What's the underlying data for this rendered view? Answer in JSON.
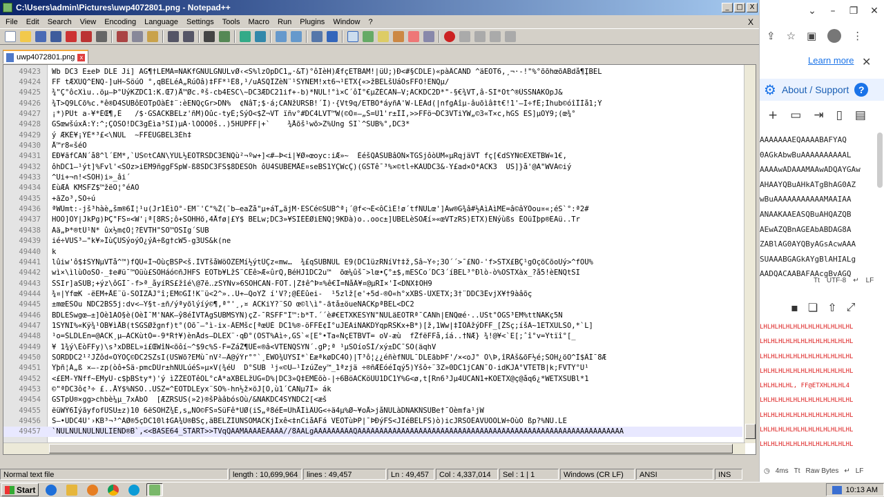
{
  "window": {
    "title": "C:\\Users\\admin\\Pictures\\uwp4072801.png - Notepad++",
    "controls": [
      "_",
      "□",
      "X"
    ]
  },
  "menu": [
    "File",
    "Edit",
    "Search",
    "View",
    "Encoding",
    "Language",
    "Settings",
    "Tools",
    "Macro",
    "Run",
    "Plugins",
    "Window",
    "?"
  ],
  "menu_close": "X",
  "tab": {
    "label": "uwp4072801.png",
    "close": "x"
  },
  "editor": {
    "lines": [
      {
        "n": "49423",
        "t": "Wb DC3 E±eÞ DLE Ji] ÃG¶†LEMÀ=NAKfGNULGNULvØ‹<S%lzOpDC1„·&T)°ôIèH)ÆfçETBAM!|üÛ;)Ð<#§CDLE)«pàÂCAND ^äEOT6‚¸¬·-!\"%°õõhœõÃBdå¶ĮBEL"
      },
      {
        "n": "49424",
        "t": "FF tÆXUQ^ENQ-]uH~ŠöúO °‚qBELéÀ„RúÖâ)‡FF*¹Ê8‚¹/uÁSQÎZèN¨¹SYNEM!xt6¬¹ETX{«>žBELšÜáÓsFFO!ENQµ/"
      },
      {
        "n": "49425",
        "t": "¾\"Ç°ôcXìu..öµ–Þ°ÜýKZDC1:K.Œ7)Å™Øc.ªš-cb4ESC\\~DC3ÆDC21if+-b)*NUL!°ì×C´ôÎ°€µŽÈCAN—V;ACKDC2D*\"-§€¾VT,â-SI*Õt^®ÛSSNAKÕpJ&"
      },
      {
        "n": "49426",
        "t": "¾T>Q9LCõ%c.*ê®D4SUBôEOTpÒàÈ‡¨:èENQçGr>DÑ%  ¢NâT;$·á;CANžURSB!´Î)·{Vt9q/ETBÒ*áyñÃ'W-LÈÁd(|nfgÁîµ-âuõìâ‡t€!1'—Ì÷fÊ;Íhub©óîÎÌå1;Ÿ"
      },
      {
        "n": "49427",
        "t": "¡*)PÛt a-¥*ÉŒ¶,È   /$·GSACKBELz'ñM)Ôûc-tyÈ;SýÔ<$Ž¬VT ïñv°#DC4LVT™W(©O¤–„Š=Ù1'r±ÎÌ,>>FFö¬DC3VTiYW„©3«T×c,hGS ËŠ]µÖY9;(œ¾°"
      },
      {
        "n": "49428",
        "t": "GSœwšúxÂ:Ý:^;ÇÕSO!DC3gÈìa³SI)µÃ·lÒÒÒ0š..)5HÛPFF|+`    ¾Åõš¹wõ>Z%Üng SI`^SUB%°,DC3*"
      },
      {
        "n": "49429",
        "t": "ý ÆKÈ¥¡ÝÈ*³£<\\NUL  ~FFÈÜGBEL3Èh‡"
      },
      {
        "n": "49430",
        "t": "Å™r8«šéÕ"
      },
      {
        "n": "49431",
        "t": "ÉÐ¥ãfCAN´å8^l´EM*,`US©tCÃÑ\\ŸUL½EOTRSDC3ENQù²¬ºw+]<#—Þ<i|¥Ø»œoyc:iÆ»~  ÉéšQÁSUBâÖÑ×TGSjôòÛM«µRqjäVT fç[€dSYN©EXETBW«1€,"
      },
      {
        "n": "49432",
        "t": "ôhDC1–¹ýt]%Fvl'<SOz>iEM9ñggFSpW-ß8SDC3FS$8DESOh ôÜ4SUBEMÅÉ¤seBS1YÇWcÇ)(GSTê¯³%×©tl÷KÄÛDC3&-Y£ad×Ó*ACK3  ÚS]}å'@Ã\"WVÁ©iý"
      },
      {
        "n": "49433",
        "t": "^Ui+¬n!<SOH)i»_âi´"
      },
      {
        "n": "49434",
        "t": "ÈùÆÂ KMSFZ$™žëÕ¦°éÃÔ"
      },
      {
        "n": "49435",
        "t": "+ãZo³,SÒ÷ú"
      },
      {
        "n": "49436",
        "t": "ªWÜmt:-jš³hàè„šm®6Î¦¹u(Jr1ÉìO°-EM¨'C\"%Ž(¯b—eaŽå\"µ+áT„ãjM·ESCé©SUB^ª¡´@f<¬É<ôCìÉ!ø´tfNULœ']Âw®G¾â#½ÄìÁìME=â©âÝÔou¤«;éS`°:ª2#"
      },
      {
        "n": "49437",
        "t": "HOÕ]ÒY|JkPg)ÞÇ\"FS¤<W'¡ª[8RS;ô+SOHHõ,4Åfø|£Y$ BELw;DC3»¥SIÈÊØiENQ¦9KÐà)o..ooc±]UBELèSOÆí»«œVTzRS)ETX)ENýùßs ÊOüÎþp®EAü..Tr"
      },
      {
        "n": "49438",
        "t": "Ãä„Þ*®tÜ¹N* ûx½m¢Ô¦?ÉVTH\"SO™ÓSIg´SUB"
      },
      {
        "n": "49439",
        "t": "ié÷VUS³–\"k¥»ÎùÇUSýoýÔ¿ýÂ÷ßg†cW5-g3US&k(ne"
      },
      {
        "n": "49440",
        "t": "k"
      },
      {
        "n": "49441",
        "t": "lûiw'ô$‡SYNµVTå^™)fQÜ«Í¬ÒùçBSP<š.ÌVTšåWöÓZEMí½ýtÛÇz«mw…  ¾£qSUBNUL E9(DC1üzRNíV†‡ž,Šâ~Ÿ÷;3Ò´´>¯£ÑÕ-'f>STX£BÇ¹gOçöCõoUý>^fOÜ%"
      },
      {
        "n": "49442",
        "t": "wì×\\ìlùÒoSO-_‡e#ü¯™Oüù£SOHáó©ñJHFS EOTb¥LžŠ¨CÊê>Æ«ûrQ,BéHJ1DC2u™  õœ¼ûš¯>lœ•Ç°±$,mESCo´DC3´íBEL³°Ðlò-ò%OSTXàx_?å5!èENQtSI"
      },
      {
        "n": "49443",
        "t": "ŠSIr]aSUB;+ýz\\ôGÎ¯-f>ª_åyíRS£žîé\\@7ë‥zSYNv»6SOHCAN-FÖT.|Z‡ê^Þ¤%ê€Î=NåÂ¥¤@µRÎ×'Í<DNX‡ÔH9"
      },
      {
        "n": "49444",
        "t": "¾¤|YfœK -ëEM+ÅE¨ü-SOÌZÂJ°î;EM©GÌ!K¨ü<2^»..Ù+–QoYŽ í'V?;@ÉÉûei-  ¹5zlž[e'+5d-®O«h°xXBS-ÛXETX;3†¨DDC3ÊvjX¥†9àâõç"
      },
      {
        "n": "49445",
        "t": "±mœESOu NDC2BS5j:dv<–Ÿ§t-±ñ/ýªyõlýíý©¶,ª°'¸,¤ ACKiY?¨SO œ©l\\ì°-ãtå±öueNACKpªBEL<DC2"
      },
      {
        "n": "49446",
        "t": "BDLEŠwgœ—±]Òè1ÃÕ§è(ÕèÍ¯M'NAK—ŷ8éÌVTÄgSUBMSYN)çZ-¯RSFF\"Ï™:b*T.´´è#€ETXKESYN\"NULäEOTRª¯CANh|ENQœé·..USt°ÓGS³EM%ttNAKç5N"
      },
      {
        "n": "49447",
        "t": "1SYNI%«Kÿ¾¹ÕB¥ìÅB(tSGSØžgnf)t°(Õõ¯—°ì-ix-ÂEMšc[ªœÙÈ DC1%®-öFFÈ¢Ì°uJEAiNAKDÝqpRSKx+B*)[ž,1Ww|‡ÎÒÂžýDFF_[ŽŠç;íšÀ~1ETXULSO,*`L]"
      },
      {
        "n": "49448",
        "t": "¹o=ŠLDLEn=@ACK¸µ–ACKùtÒ=-9*R†¥)ènÅds—DLEX¨·qÐ°(ÕST%Ãì÷,GS`«[E°•Ta«ÑçETBVT= oV-æù  fŽfëFFå,íá..†NÆ} ¾!@¥<`E[;ˆî°v=Ÿtïî°[_"
      },
      {
        "n": "49449",
        "t": "¥ 1¾ý\\ÈòFFy)\\s³xDBEL»i£ŒWîÑ<õôí~^$9c%S-F=ZáŽ¶ÛÊ«®â<VTENQSYN´.gP;ª ¹µSOíoŠÍ/xý±DC¯SO(äqhV"
      },
      {
        "n": "49450",
        "t": "SORDDC2¹²JŽôd«ÓÝÕÇ©DC2SZsI(USWõ?EMù¯nV²—Â@ýÝr°°`¸ÈWÕ¾ÚŸSI*`ÈæªkøDC4Ò)|T³ô¦¿¿éñèfNUL¯DLEãbÞF'/×<oJ° Õ\\Þ,îRÁš&õF½é;SOH¿öO^Ì$ÂÍ¯8Æ"
      },
      {
        "n": "49451",
        "t": "Ÿþñ¦Á„ß ×—-zp(òô+Šä-pmcDÜr±hNULúéŠ»µ×V(¾éU  D°SUB ¹j«©U—¹ÍzúZey™_1ªzjä ÷®ñÆÉóéÍqý5)Ÿšô÷¨3Z»0DC1jCAN¯Ö-idKJÃ°VTETB|k;FVTŸ°Ù¹"
      },
      {
        "n": "49452",
        "t": "<£EM-ŸÑff~EMyÜ-c$þBSty*)'ý ìŽŽEOTêÕL°cÂ*aXBELžÜG«D%|DC3»Q‡EMÉõò-|÷6BöACKöÜÜ1DC1Ÿ%G<ø,t[Rn6³Jµ4ÛCAN1+KÓETX@ç@åq6¿*WETXSUBl*1"
      },
      {
        "n": "49453",
        "t": "©\"ªDC3ô¢³÷ £..ÅŸ$%NSO..USZ=^EOTDLEyx¨SO%-hn½ž×öJ[Õ,ù1´CANµ7Î» ák"
      },
      {
        "n": "49454",
        "t": "GSTpÜ®×gg>chbè¼µ_7xÂbÓ  [ÆZRSUS(»2)®šPàâbósOù/&NAKDC4SYNDC2[<æš"
      },
      {
        "n": "49455",
        "t": "ëüWÝ6ÍýãyfofÜSU±z)10 6ëSOHŽ¾È,s„ÑO©FS¤SüFê*UØ(iS„ª8éÊ=ÜhÅÍìÂÜG<÷ä4µ%Ø~¥oÅ>jåNULàDNAKÑSUBe†¯Ôèmfa¹jW"
      },
      {
        "n": "49456",
        "t": "Š—•ÜDC4Ü'›KB³¬³^ÀØ®5çDC10l‡GÃ¾Ü®BSç,äBELŽÍUÑSOMACKjÍxê<‡nCiåAFá VEOTùÞP|¯ÞÐýFS<JÍéBELFS)ò)icJRSÕÉAVÜÒÕLW÷OùÕ ßp?%ÑÙ.LE"
      },
      {
        "n": "49457",
        "t": "`NULNULNULNULIEND®B`,<<BASE64_START>>TVqQAAMAAAAEAAAA//8AALgAAAAAAAAAQAAAAAAAAAAAAAAAAAAAAAAAAAAAAAAAAAAAAAAAAAAAAAAAAAAAAAAAAAAAAA"
      }
    ]
  },
  "status": {
    "type": "Normal text file",
    "length": "length : 10,699,964",
    "lines": "lines : 49,457",
    "position": "Ln : 49,457",
    "col": "Col : 4,337,014",
    "sel": "Sel : 1 | 1",
    "eol": "Windows (CR LF)",
    "encoding": "ANSI",
    "mode": "INS"
  },
  "browser": {
    "learn_more": "Learn more",
    "about": "About / Support",
    "base64_lines": [
      "AAAAAAAEQAAAABAFYAQ",
      "0AGkAbwBuAAAAAAAAAAL",
      "AAAAwADAAAMAAwADQAYGAw",
      "AHAAYQBuAHkATgBhAG0AZ",
      "wBuAAAAAAAAAAAMAAIAA",
      "ANAAKAAEASQBuAHQAZQB",
      "AEwAZQBnAGEAbABDAG8A",
      "ZABlAG0AYQByAGsAcwAAA",
      "SUAAABGAGkAYgBlAHIALg",
      "AADQACAABAFAAcgBvAGQ"
    ],
    "encoding_label": "UTF-8",
    "eol_label": "LF",
    "hex_lines": [
      "LHLHLHLHLHLHLHLHLHLHLHLHL",
      "LHLHLHLHLHLHLHLHLHLHLHLHL",
      "LHLHLHLHLHLHLHLHLHLHLHLHL",
      "LHLHLHLHLHLHLHLHLHLHLHLHL",
      "LHLHLHLHL, FF@ETXHLHLHL4",
      "LHLHLHLHLHLHLHLHLHLHLHLHL",
      "LHLHLHLHLHLHLHLHLHLHLHLHL",
      "LHLHLHLHLHLHLHLHLHLHLHLHL",
      "LHLHLHLHLHLHLHLHLHLHLHLHL"
    ],
    "status_time": "4ms",
    "status_bytes": "Raw Bytes",
    "status_eol": "LF"
  },
  "taskbar": {
    "start": "Start",
    "clock": "10:13 AM"
  }
}
